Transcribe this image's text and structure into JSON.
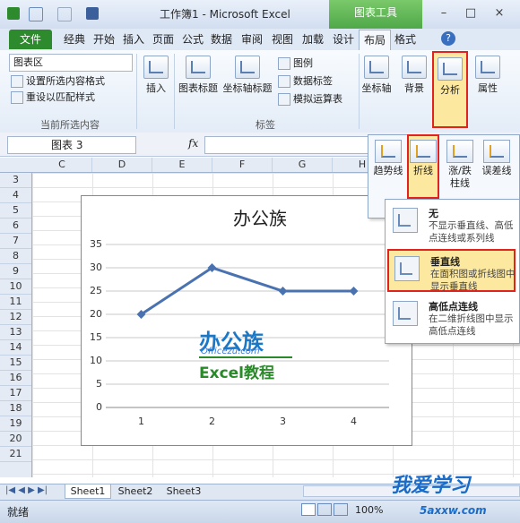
{
  "window": {
    "title": "工作簿1 - Microsoft Excel",
    "context_tab_group": "图表工具",
    "controls": {
      "help": "?"
    }
  },
  "tabs": [
    "文件",
    "经典",
    "开始",
    "插入",
    "页面",
    "公式",
    "数据",
    "审阅",
    "视图",
    "加载",
    "设计",
    "布局",
    "格式"
  ],
  "active_tab": "布局",
  "ribbon": {
    "current_selection": {
      "dropdown_value": "图表区",
      "format_selection": "设置所选内容格式",
      "reset_style": "重设以匹配样式",
      "group_label": "当前所选内容"
    },
    "insert": {
      "label": "插入"
    },
    "labels_group": {
      "chart_title": "图表标题",
      "axis_title": "坐标轴标题",
      "legend": "图例",
      "data_labels": "数据标签",
      "data_table": "模拟运算表",
      "group_label": "标签"
    },
    "axes": {
      "label": "坐标轴"
    },
    "background": {
      "label": "背景"
    },
    "analysis": {
      "label": "分析"
    },
    "properties": {
      "label": "属性"
    }
  },
  "formula_bar": {
    "name_box": "图表 3",
    "fx": "fx"
  },
  "columns": [
    "C",
    "D",
    "E",
    "F",
    "G",
    "H"
  ],
  "rows": [
    "3",
    "4",
    "5",
    "6",
    "7",
    "8",
    "9",
    "10",
    "11",
    "12",
    "13",
    "14",
    "15",
    "16",
    "17",
    "18",
    "19",
    "20",
    "21"
  ],
  "analysis_panel": {
    "trendline": "趋势线",
    "lines": "折线",
    "updown_bars_l1": "涨/跌",
    "updown_bars_l2": "柱线",
    "error_bars": "误差线"
  },
  "lines_menu": [
    {
      "title": "无",
      "desc": "不显示垂直线、高低点连线或系列线"
    },
    {
      "title": "垂直线",
      "desc": "在面积图或折线图中显示垂直线"
    },
    {
      "title": "高低点连线",
      "desc": "在二维折线图中显示高低点连线"
    }
  ],
  "watermark": {
    "brand": "办公族",
    "url": "Officezu.com",
    "tagline": "Excel教程"
  },
  "chart_data": {
    "type": "line",
    "title": "办公族",
    "categories": [
      "1",
      "2",
      "3",
      "4"
    ],
    "series": [
      {
        "values": [
          20,
          30,
          25,
          25
        ]
      }
    ],
    "ylim": [
      0,
      35
    ],
    "yticks": [
      0,
      5,
      10,
      15,
      20,
      25,
      30,
      35
    ],
    "grid": true,
    "color": "#4a72b0"
  },
  "sheets": [
    "Sheet1",
    "Sheet2",
    "Sheet3"
  ],
  "status": {
    "ready": "就绪",
    "zoom": "100%"
  },
  "logo": {
    "text": "我爱学习",
    "url": "5axxw.com"
  }
}
